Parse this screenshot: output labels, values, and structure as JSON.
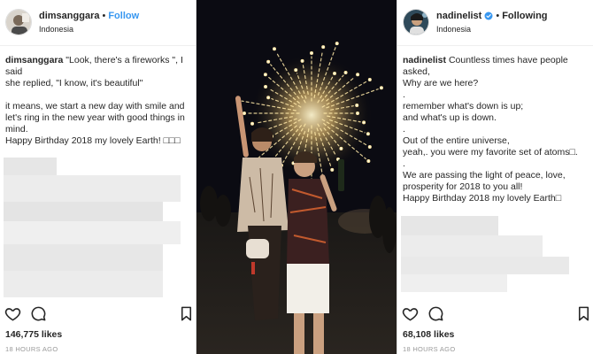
{
  "left_post": {
    "username": "dimsanggara",
    "dot": "•",
    "follow_label": "Follow",
    "location": "Indonesia",
    "caption_user": "dimsanggara",
    "caption_lines": [
      "\"Look, there's a fireworks \", I said",
      "she replied, \"I know, it's beautiful\""
    ],
    "caption_lines_2": [
      "it means, we start a new day with smile and let's ring in the new year with good things in mind.",
      "Happy Birthday 2018 my lovely Earth! □□□"
    ],
    "likes": "146,775 likes",
    "time": "18 HOURS AGO"
  },
  "right_post": {
    "username": "nadinelist",
    "dot": "•",
    "following_label": "Following",
    "location": "Indonesia",
    "caption_user": "nadinelist",
    "caption_first": "Countless times have people asked,",
    "caption_lines": [
      "Why are we here?",
      ".",
      "remember what's down is up;",
      "and what's up is down.",
      ".",
      "Out of the entire universe,",
      "yeah,. you were my favorite set of atoms□.",
      ".",
      "We are passing the light of peace, love, prosperity for 2018 to you all!",
      "Happy Birthday 2018 my lovely Earth□"
    ],
    "likes": "68,108 likes",
    "time": "18 HOURS AGO"
  },
  "icons": {
    "heart": "heart-icon",
    "comment": "comment-icon",
    "bookmark": "bookmark-icon",
    "verified": "verified-badge-icon"
  },
  "colors": {
    "link_blue": "#3897f0",
    "verified_blue": "#3897f0",
    "text": "#262626",
    "muted": "#999999",
    "blur_gray": "#e8e8e8"
  }
}
